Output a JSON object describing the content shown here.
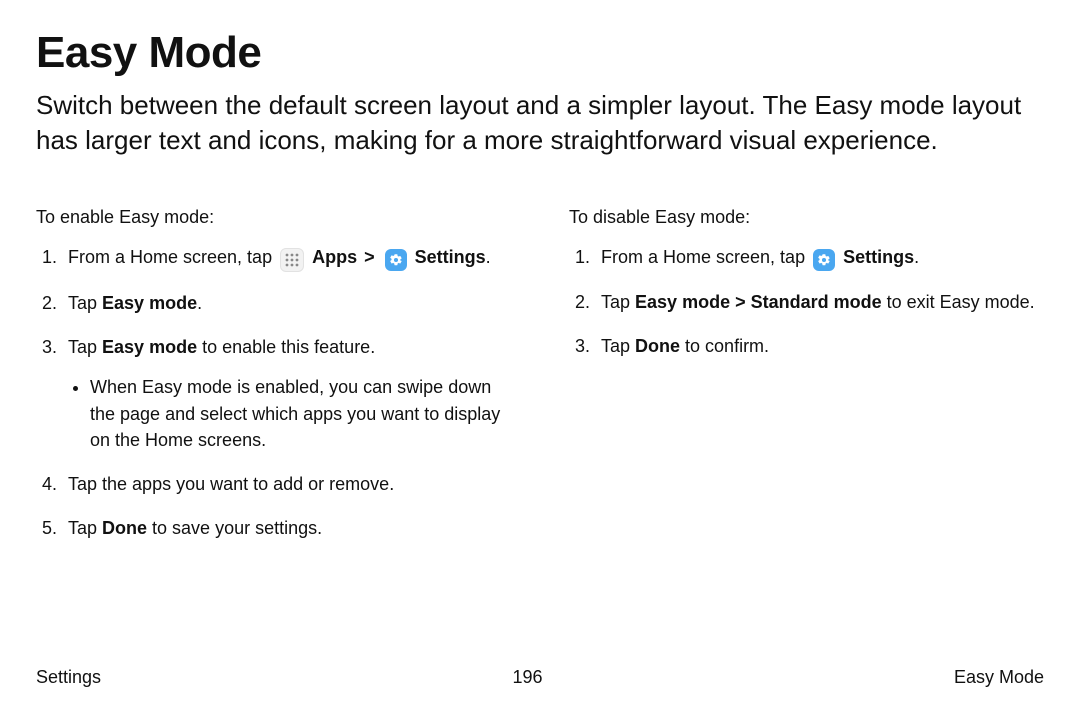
{
  "title": "Easy Mode",
  "intro": "Switch between the default screen layout and a simpler layout. The Easy mode layout has larger text and icons, making for a more straightforward visual experience.",
  "enable": {
    "heading": "To enable Easy mode:",
    "step1_a": "From a Home screen, tap ",
    "apps_label": "Apps",
    "caret": ">",
    "settings_label": "Settings",
    "period": ".",
    "step2_a": "Tap ",
    "step2_b": "Easy mode",
    "step3_a": "Tap ",
    "step3_b": "Easy mode",
    "step3_c": " to enable this feature.",
    "sub": "When Easy mode is enabled, you can swipe down the page and select which apps you want to display on the Home screens.",
    "step4": "Tap the apps you want to add or remove.",
    "step5_a": "Tap ",
    "step5_b": "Done",
    "step5_c": " to save your settings."
  },
  "disable": {
    "heading": "To disable Easy mode:",
    "step1_a": "From a Home screen, tap ",
    "settings_label": "Settings",
    "period": ".",
    "step2_a": "Tap ",
    "step2_b": "Easy mode > Standard mode",
    "step2_c": " to exit Easy mode.",
    "step3_a": "Tap ",
    "step3_b": "Done",
    "step3_c": " to confirm."
  },
  "footer": {
    "left": "Settings",
    "center": "196",
    "right": "Easy Mode"
  }
}
